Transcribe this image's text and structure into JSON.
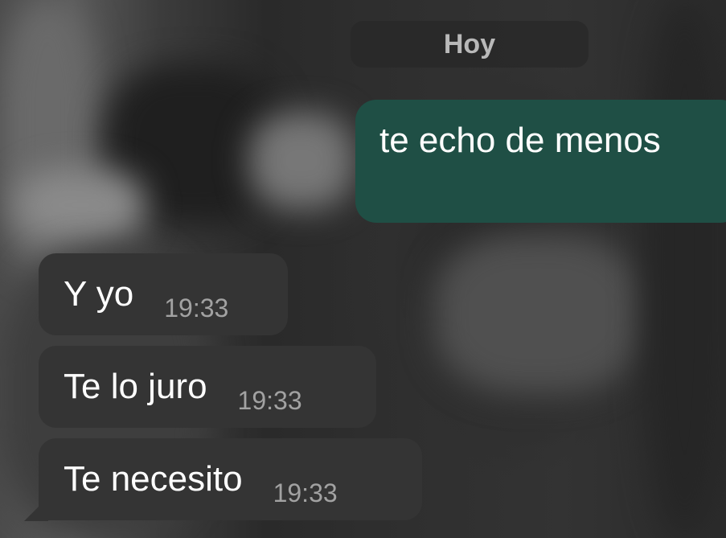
{
  "chat": {
    "date_separator": "Hoy",
    "messages": [
      {
        "direction": "outgoing",
        "text": "te echo de menos",
        "time": ""
      },
      {
        "direction": "incoming",
        "text": "Y yo",
        "time": "19:33"
      },
      {
        "direction": "incoming",
        "text": "Te lo juro",
        "time": "19:33"
      },
      {
        "direction": "incoming",
        "text": "Te necesito",
        "time": "19:33"
      }
    ]
  },
  "colors": {
    "outgoing_bubble": "#1f4f45",
    "incoming_bubble": "#343434",
    "timestamp_text": "#a2a2a2"
  }
}
